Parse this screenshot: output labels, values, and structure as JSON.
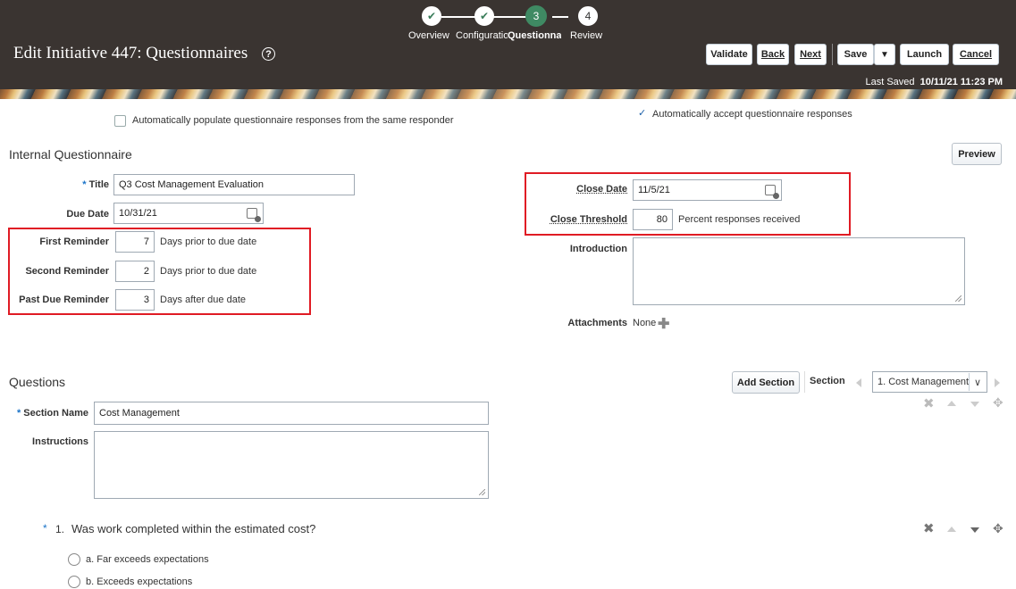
{
  "train": {
    "steps": [
      {
        "label": "Overview",
        "state": "done",
        "number": ""
      },
      {
        "label": "Configuratio",
        "state": "done",
        "number": ""
      },
      {
        "label": "Questionna",
        "state": "current",
        "number": "3"
      },
      {
        "label": "Review",
        "state": "todo",
        "number": "4"
      }
    ]
  },
  "header": {
    "title": "Edit Initiative 447: Questionnaires",
    "buttons": {
      "validate": "Validate",
      "back": "Back",
      "next": "Next",
      "save": "Save",
      "launch": "Launch",
      "cancel": "Cancel"
    },
    "last_saved_label": "Last Saved",
    "last_saved_value": "10/11/21 11:23 PM"
  },
  "options": {
    "auto_populate": {
      "label": "Automatically populate questionnaire responses from the same responder",
      "checked": false
    },
    "auto_accept": {
      "label": "Automatically accept questionnaire responses",
      "checked": true
    }
  },
  "internal": {
    "heading": "Internal Questionnaire",
    "preview_label": "Preview",
    "title_label": "Title",
    "title_value": "Q3 Cost Management Evaluation",
    "due_date_label": "Due Date",
    "due_date_value": "10/31/21",
    "first_reminder_label": "First Reminder",
    "first_reminder_value": "7",
    "first_reminder_suffix": "Days prior to due date",
    "second_reminder_label": "Second Reminder",
    "second_reminder_value": "2",
    "second_reminder_suffix": "Days prior to due date",
    "past_due_label": "Past Due Reminder",
    "past_due_value": "3",
    "past_due_suffix": "Days after due date",
    "close_date_label": "Close Date",
    "close_date_value": "11/5/21",
    "close_threshold_label": "Close Threshold",
    "close_threshold_value": "80",
    "close_threshold_suffix": "Percent responses received",
    "introduction_label": "Introduction",
    "attachments_label": "Attachments",
    "attachments_value": "None"
  },
  "questions": {
    "heading": "Questions",
    "add_section_label": "Add Section",
    "section_label": "Section",
    "section_selected": "1. Cost Management",
    "section_name_label": "Section Name",
    "section_name_value": "Cost Management",
    "instructions_label": "Instructions",
    "q1_number": "1.",
    "q1_text": "Was work completed within the estimated cost?",
    "q1_options": [
      "a. Far exceeds expectations",
      "b. Exceeds expectations"
    ]
  },
  "colors": {
    "header_bg": "#3a3431",
    "current_step": "#3f8a63",
    "highlight_box": "#e01b24",
    "required_marker": "#1a73c8"
  }
}
